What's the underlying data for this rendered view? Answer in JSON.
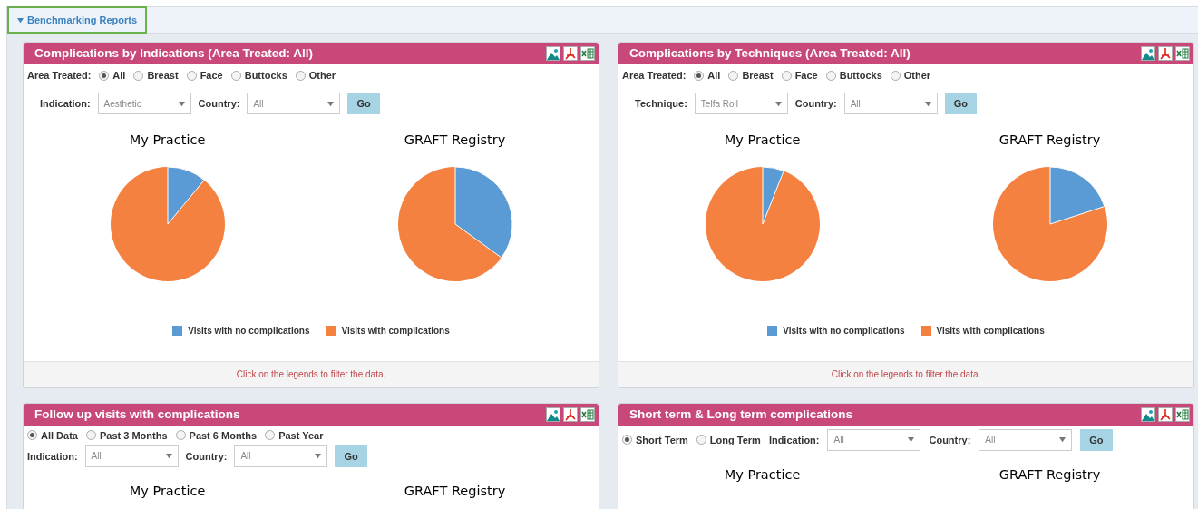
{
  "section": {
    "title": "Benchmarking Reports",
    "expanded": true
  },
  "cards": [
    {
      "title": "Complications by Indications (Area Treated: All)",
      "radio_group": {
        "label": "Area Treated:",
        "options": [
          {
            "label": "All",
            "selected": true
          },
          {
            "label": "Breast",
            "selected": false
          },
          {
            "label": "Face",
            "selected": false
          },
          {
            "label": "Buttocks",
            "selected": false
          },
          {
            "label": "Other",
            "selected": false
          }
        ]
      },
      "filters": [
        {
          "kind": "label",
          "text": "Indication:"
        },
        {
          "kind": "select",
          "value": "Aesthetic"
        },
        {
          "kind": "label",
          "text": "Country:"
        },
        {
          "kind": "select",
          "value": "All"
        },
        {
          "kind": "button",
          "label": "Go"
        }
      ],
      "filters_inline": false,
      "charts": [
        {
          "title": "My Practice",
          "kind": "picture"
        },
        {
          "title": "GRAFT Registry",
          "kind": "picture"
        }
      ],
      "legend": [
        {
          "label": "Visits with no complications",
          "color": "#5b9bd5"
        },
        {
          "label": "Visits with complications",
          "color": "#f4813f"
        }
      ],
      "footer": "Click on the legends to filter the data."
    },
    {
      "title": "Complications by Techniques (Area Treated: All)",
      "radio_group": {
        "label": "Area Treated:",
        "options": [
          {
            "label": "All",
            "selected": true
          },
          {
            "label": "Breast",
            "selected": false
          },
          {
            "label": "Face",
            "selected": false
          },
          {
            "label": "Buttocks",
            "selected": false
          },
          {
            "label": "Other",
            "selected": false
          }
        ]
      },
      "filters": [
        {
          "kind": "label",
          "text": "Technique:"
        },
        {
          "kind": "select",
          "value": "Telfa Roll"
        },
        {
          "kind": "label",
          "text": "Country:"
        },
        {
          "kind": "select",
          "value": "All"
        },
        {
          "kind": "button",
          "label": "Go"
        }
      ],
      "filters_inline": false,
      "charts": [
        {
          "title": "My Practice",
          "kind": "picture"
        },
        {
          "title": "GRAFT Registry",
          "kind": "picture"
        }
      ],
      "legend": [
        {
          "label": "Visits with no complications",
          "color": "#5b9bd5"
        },
        {
          "label": "Visits with complications",
          "color": "#f4813f"
        }
      ],
      "footer": "Click on the legends to filter the data."
    },
    {
      "title": "Follow up visits with complications",
      "radio_group": {
        "options": [
          {
            "label": "All Data",
            "selected": true
          },
          {
            "label": "Past 3 Months",
            "selected": false
          },
          {
            "label": "Past 6 Months",
            "selected": false
          },
          {
            "label": "Past Year",
            "selected": false
          }
        ]
      },
      "filters": [
        {
          "kind": "label",
          "text": "Indication:"
        },
        {
          "kind": "select",
          "value": "All"
        },
        {
          "kind": "label",
          "text": "Country:"
        },
        {
          "kind": "select",
          "value": "All"
        },
        {
          "kind": "button",
          "label": "Go"
        }
      ],
      "filters_inline": false,
      "charts": [
        {
          "title": "My Practice"
        },
        {
          "title": "GRAFT Registry"
        }
      ]
    },
    {
      "title": "Short term & Long term complications",
      "radio_group": {
        "options": [
          {
            "label": "Short Term",
            "selected": true
          },
          {
            "label": "Long Term",
            "selected": false
          }
        ]
      },
      "filters": [
        {
          "kind": "label",
          "text": "Indication:"
        },
        {
          "kind": "select",
          "value": "All"
        },
        {
          "kind": "label",
          "text": "Country:"
        },
        {
          "kind": "select",
          "value": "All"
        },
        {
          "kind": "button",
          "label": "Go"
        }
      ],
      "filters_inline": true,
      "charts": [
        {
          "title": "My Practice"
        },
        {
          "title": "GRAFT Registry"
        }
      ]
    }
  ]
}
